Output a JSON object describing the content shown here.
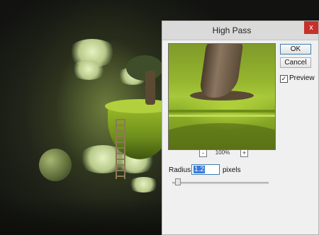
{
  "dialog": {
    "title": "High Pass",
    "close_glyph": "x",
    "ok_label": "OK",
    "cancel_label": "Cancel",
    "preview_label": "Preview",
    "preview_checked": true,
    "check_glyph": "✓",
    "zoom_out_glyph": "-",
    "zoom_in_glyph": "+",
    "zoom_level": "100%",
    "radius_label": "Radius:",
    "radius_value": "1.2",
    "radius_units": "pixels",
    "radius_slider_fraction": 0.03
  },
  "colors": {
    "close_button": "#c7302b",
    "selection": "#3a78d8"
  }
}
